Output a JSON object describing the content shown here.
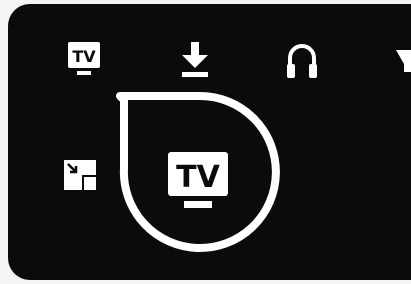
{
  "menu": {
    "items": [
      {
        "id": "tv",
        "icon": "tv-icon",
        "label": "TV"
      },
      {
        "id": "download",
        "icon": "download-icon"
      },
      {
        "id": "audio",
        "icon": "headphones-icon"
      },
      {
        "id": "more",
        "icon": "partial-icon"
      }
    ],
    "secondary": [
      {
        "id": "pip",
        "icon": "picture-in-picture-icon"
      }
    ],
    "selected": {
      "id": "tv",
      "icon": "tv-icon",
      "label": "TV"
    }
  },
  "colors": {
    "panel": "#0b0b0b",
    "icon": "#ffffff",
    "ring": "#ffffff"
  }
}
